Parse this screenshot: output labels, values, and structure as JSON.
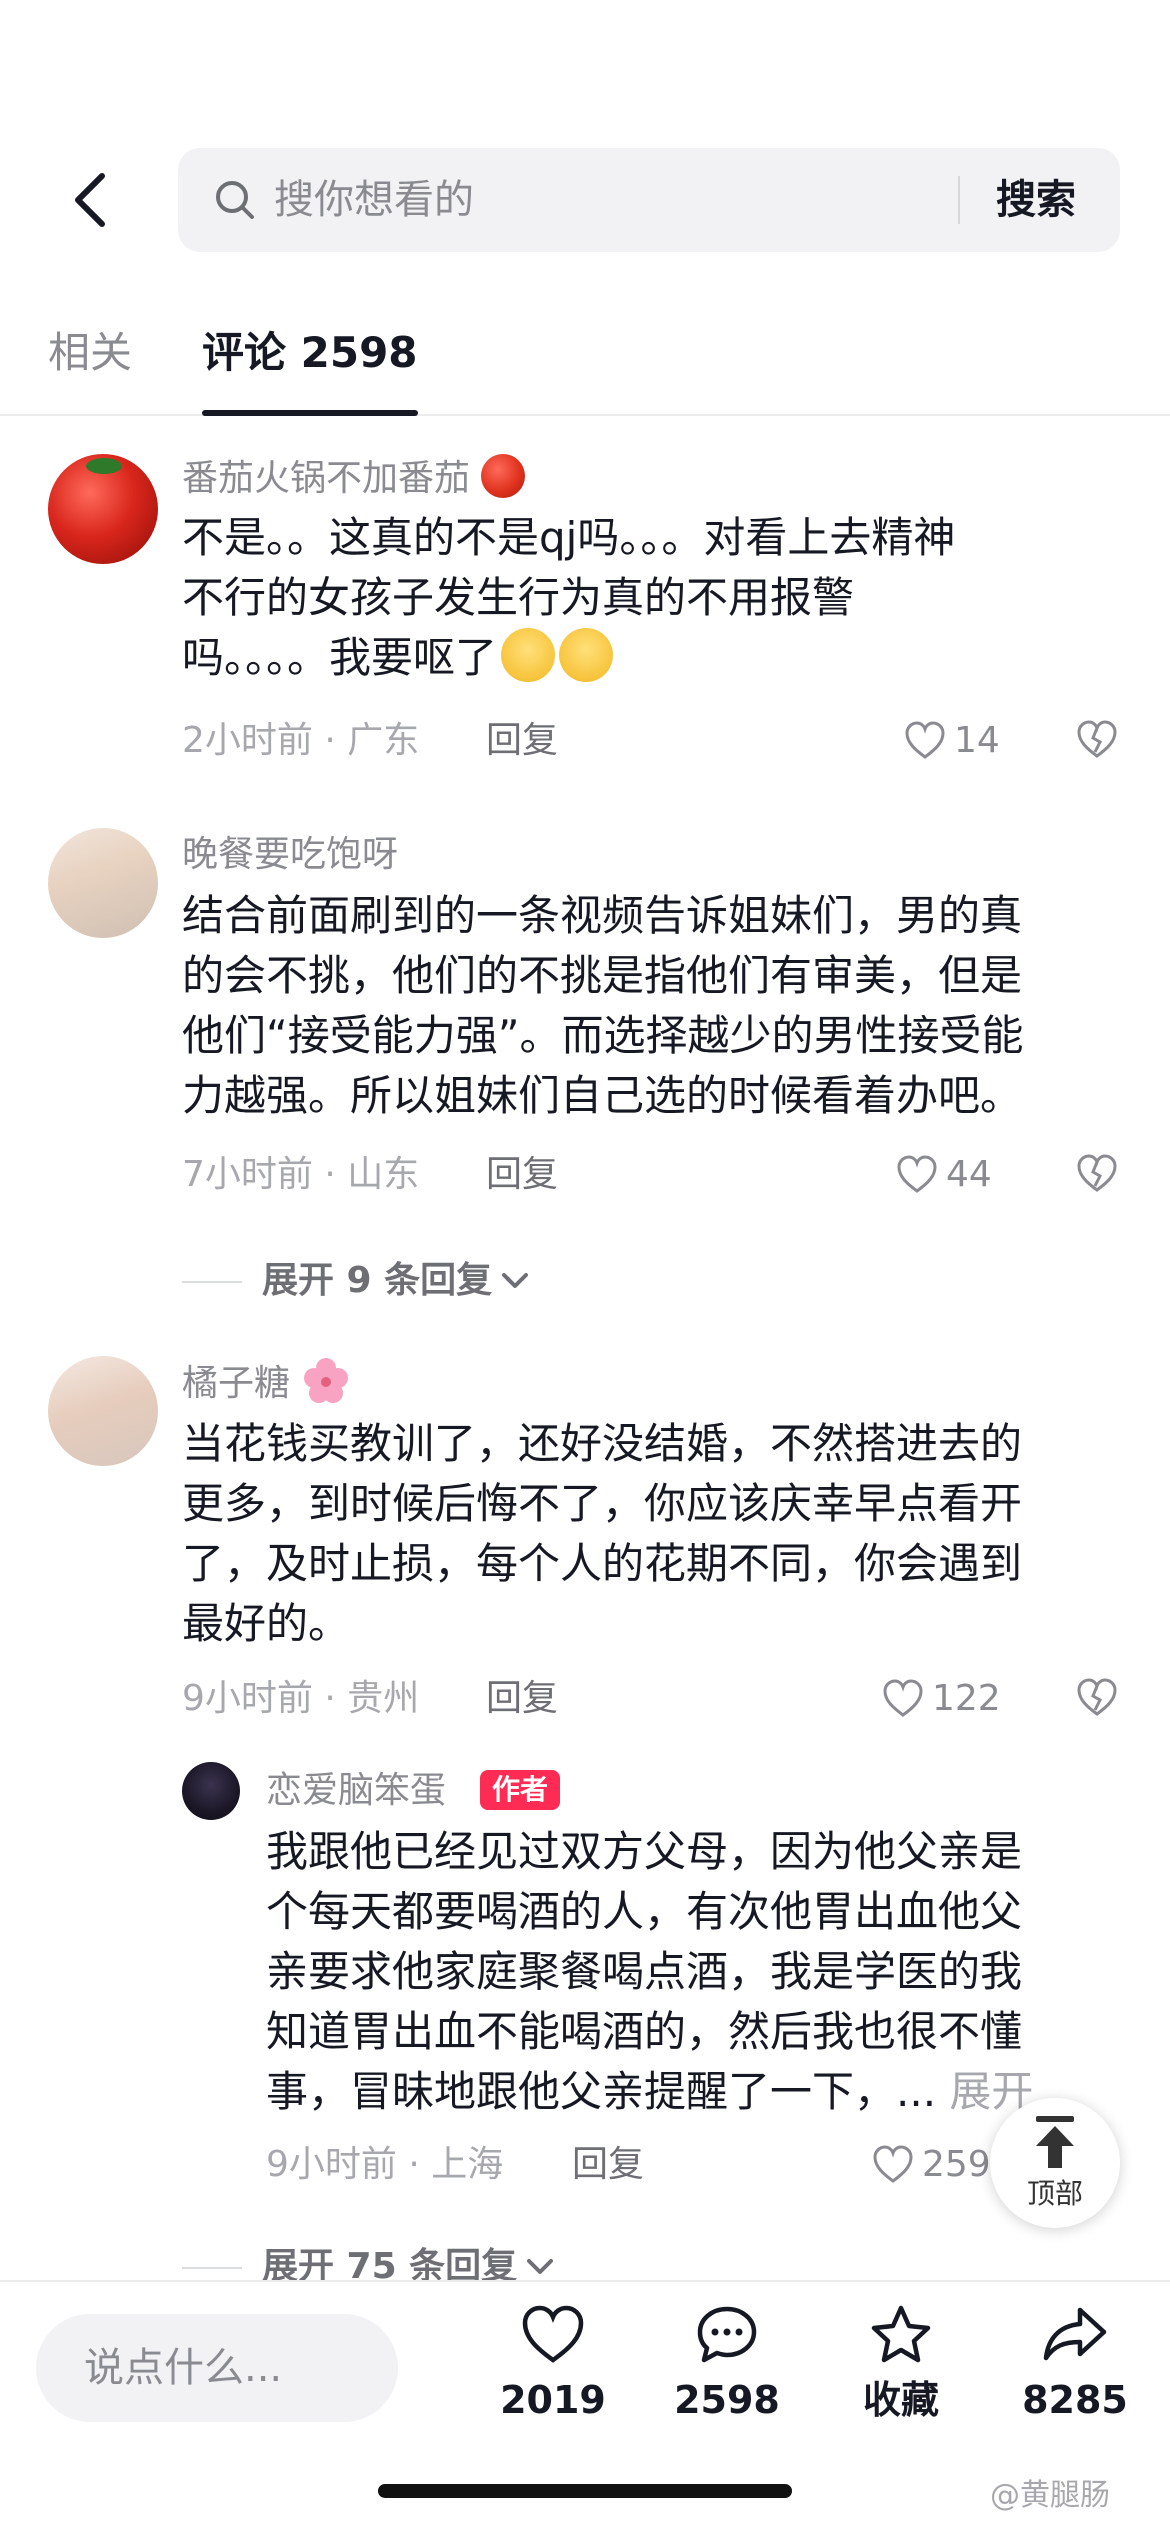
{
  "header": {
    "search_placeholder": "搜你想看的",
    "search_button": "搜索"
  },
  "tabs": [
    {
      "label": "相关",
      "active": false
    },
    {
      "label": "评论 2598",
      "active": true
    }
  ],
  "comments": [
    {
      "username": "番茄火锅不加番茄",
      "text_line1": "不是。。这真的不是qj吗。。。对看上去精神",
      "text_line2": "不行的女孩子发生行为真的不用报警",
      "text_line3": "吗。。。。我要呕了",
      "meta": "2小时前 · 广东",
      "reply": "回复",
      "likes": "14"
    },
    {
      "username": "晚餐要吃饱呀",
      "text_line1": "结合前面刷到的一条视频告诉姐妹们，男的真",
      "text_line2": "的会不挑，他们的不挑是指他们有审美，但是",
      "text_line3": "他们“接受能力强”。而选择越少的男性接受能",
      "text_line4": "力越强。所以姐妹们自己选的时候看着办吧。",
      "meta": "7小时前 · 山东",
      "reply": "回复",
      "likes": "44",
      "expand": "展开 9 条回复"
    },
    {
      "username": "橘子糖",
      "text_line1": "当花钱买教训了，还好没结婚，不然搭进去的",
      "text_line2": "更多，到时候后悔不了，你应该庆幸早点看开",
      "text_line3": "了，及时止损，每个人的花期不同，你会遇到",
      "text_line4": "最好的。",
      "meta": "9小时前 · 贵州",
      "reply": "回复",
      "likes": "122"
    }
  ],
  "author_reply": {
    "username": "恋爱脑笨蛋",
    "badge": "作者",
    "text_line1": "我跟他已经见过双方父母，因为他父亲是",
    "text_line2": "个每天都要喝酒的人，有次他胃出血他父",
    "text_line3": "亲要求他家庭聚餐喝点酒，我是学医的我",
    "text_line4": "知道胃出血不能喝酒的，然后我也很不懂",
    "text_line5": "事，冒昧地跟他父亲提醒了一下，...",
    "more": "展开",
    "meta": "9小时前 · 上海",
    "reply": "回复",
    "likes": "259",
    "expand": "展开 75 条回复"
  },
  "top_button": "顶部",
  "bottom_bar": {
    "input_placeholder": "说点什么...",
    "like_count": "2019",
    "comment_count": "2598",
    "favorite_label": "收藏",
    "share_count": "8285"
  },
  "watermark": "@黄腿肠"
}
